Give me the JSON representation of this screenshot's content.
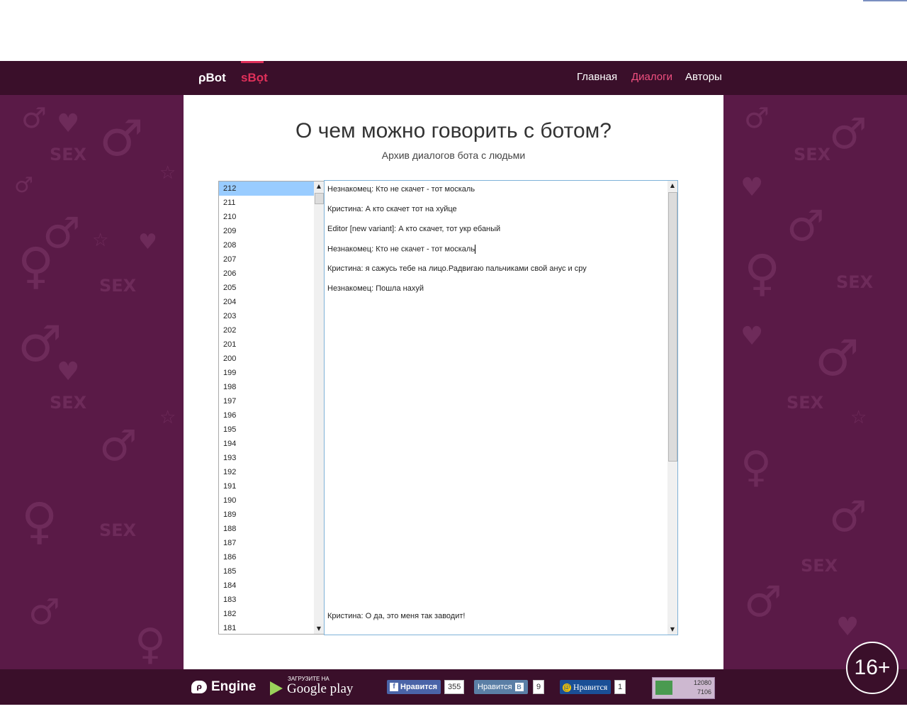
{
  "colors": {
    "nav_bg": "#3a0f2a",
    "page_bg": "#5a1a47",
    "accent": "#e0305a",
    "active_link": "#f05080",
    "selected_row": "#99ccff"
  },
  "header": {
    "brand_pbot": "ρBot",
    "brand_sbot": "sBọt",
    "nav": {
      "home": "Главная",
      "dialogs": "Диалоги",
      "authors": "Авторы"
    }
  },
  "main": {
    "title": "О чем можно говорить с ботом?",
    "subtitle": "Архив диалогов бота с людьми"
  },
  "dialog_list": {
    "selected": "212",
    "items": [
      "212",
      "211",
      "210",
      "209",
      "208",
      "207",
      "206",
      "205",
      "204",
      "203",
      "202",
      "201",
      "200",
      "199",
      "198",
      "197",
      "196",
      "195",
      "194",
      "193",
      "192",
      "191",
      "190",
      "189",
      "188",
      "187",
      "186",
      "185",
      "184",
      "183",
      "182",
      "181"
    ]
  },
  "chat": {
    "messages": [
      "Незнакомец: Кто не скачет - тот москаль",
      "Кристина: А кто скачет тот на хуйце",
      "Editor [new variant]: А кто скачет, тот укр ебаный",
      "Незнакомец: Кто не скачет - тот москаль",
      "Кристина: я сажусь тебе на лицо.Радвигаю пальчиками свой анус и сру",
      "Незнакомец: Пошла нахуй"
    ],
    "last_message": "Кристина: О да, это меня так заводит!"
  },
  "footer": {
    "engine_label": "Engine",
    "google_play_small": "ЗАГРУЗИТЕ НА",
    "google_play_big": "Google play",
    "fb": {
      "label": "Нравится",
      "count": "355"
    },
    "vk": {
      "label": "Нравится",
      "count": "9"
    },
    "mail": {
      "label": "Нравится",
      "count": "1"
    },
    "counter": {
      "line1": "12080",
      "line2": "7106"
    }
  },
  "age_badge": "16+",
  "icons": {
    "engine": "engine-logo-icon",
    "google_play": "google-play-icon",
    "facebook": "facebook-icon",
    "vk": "vk-icon",
    "mail": "mail-at-icon"
  }
}
